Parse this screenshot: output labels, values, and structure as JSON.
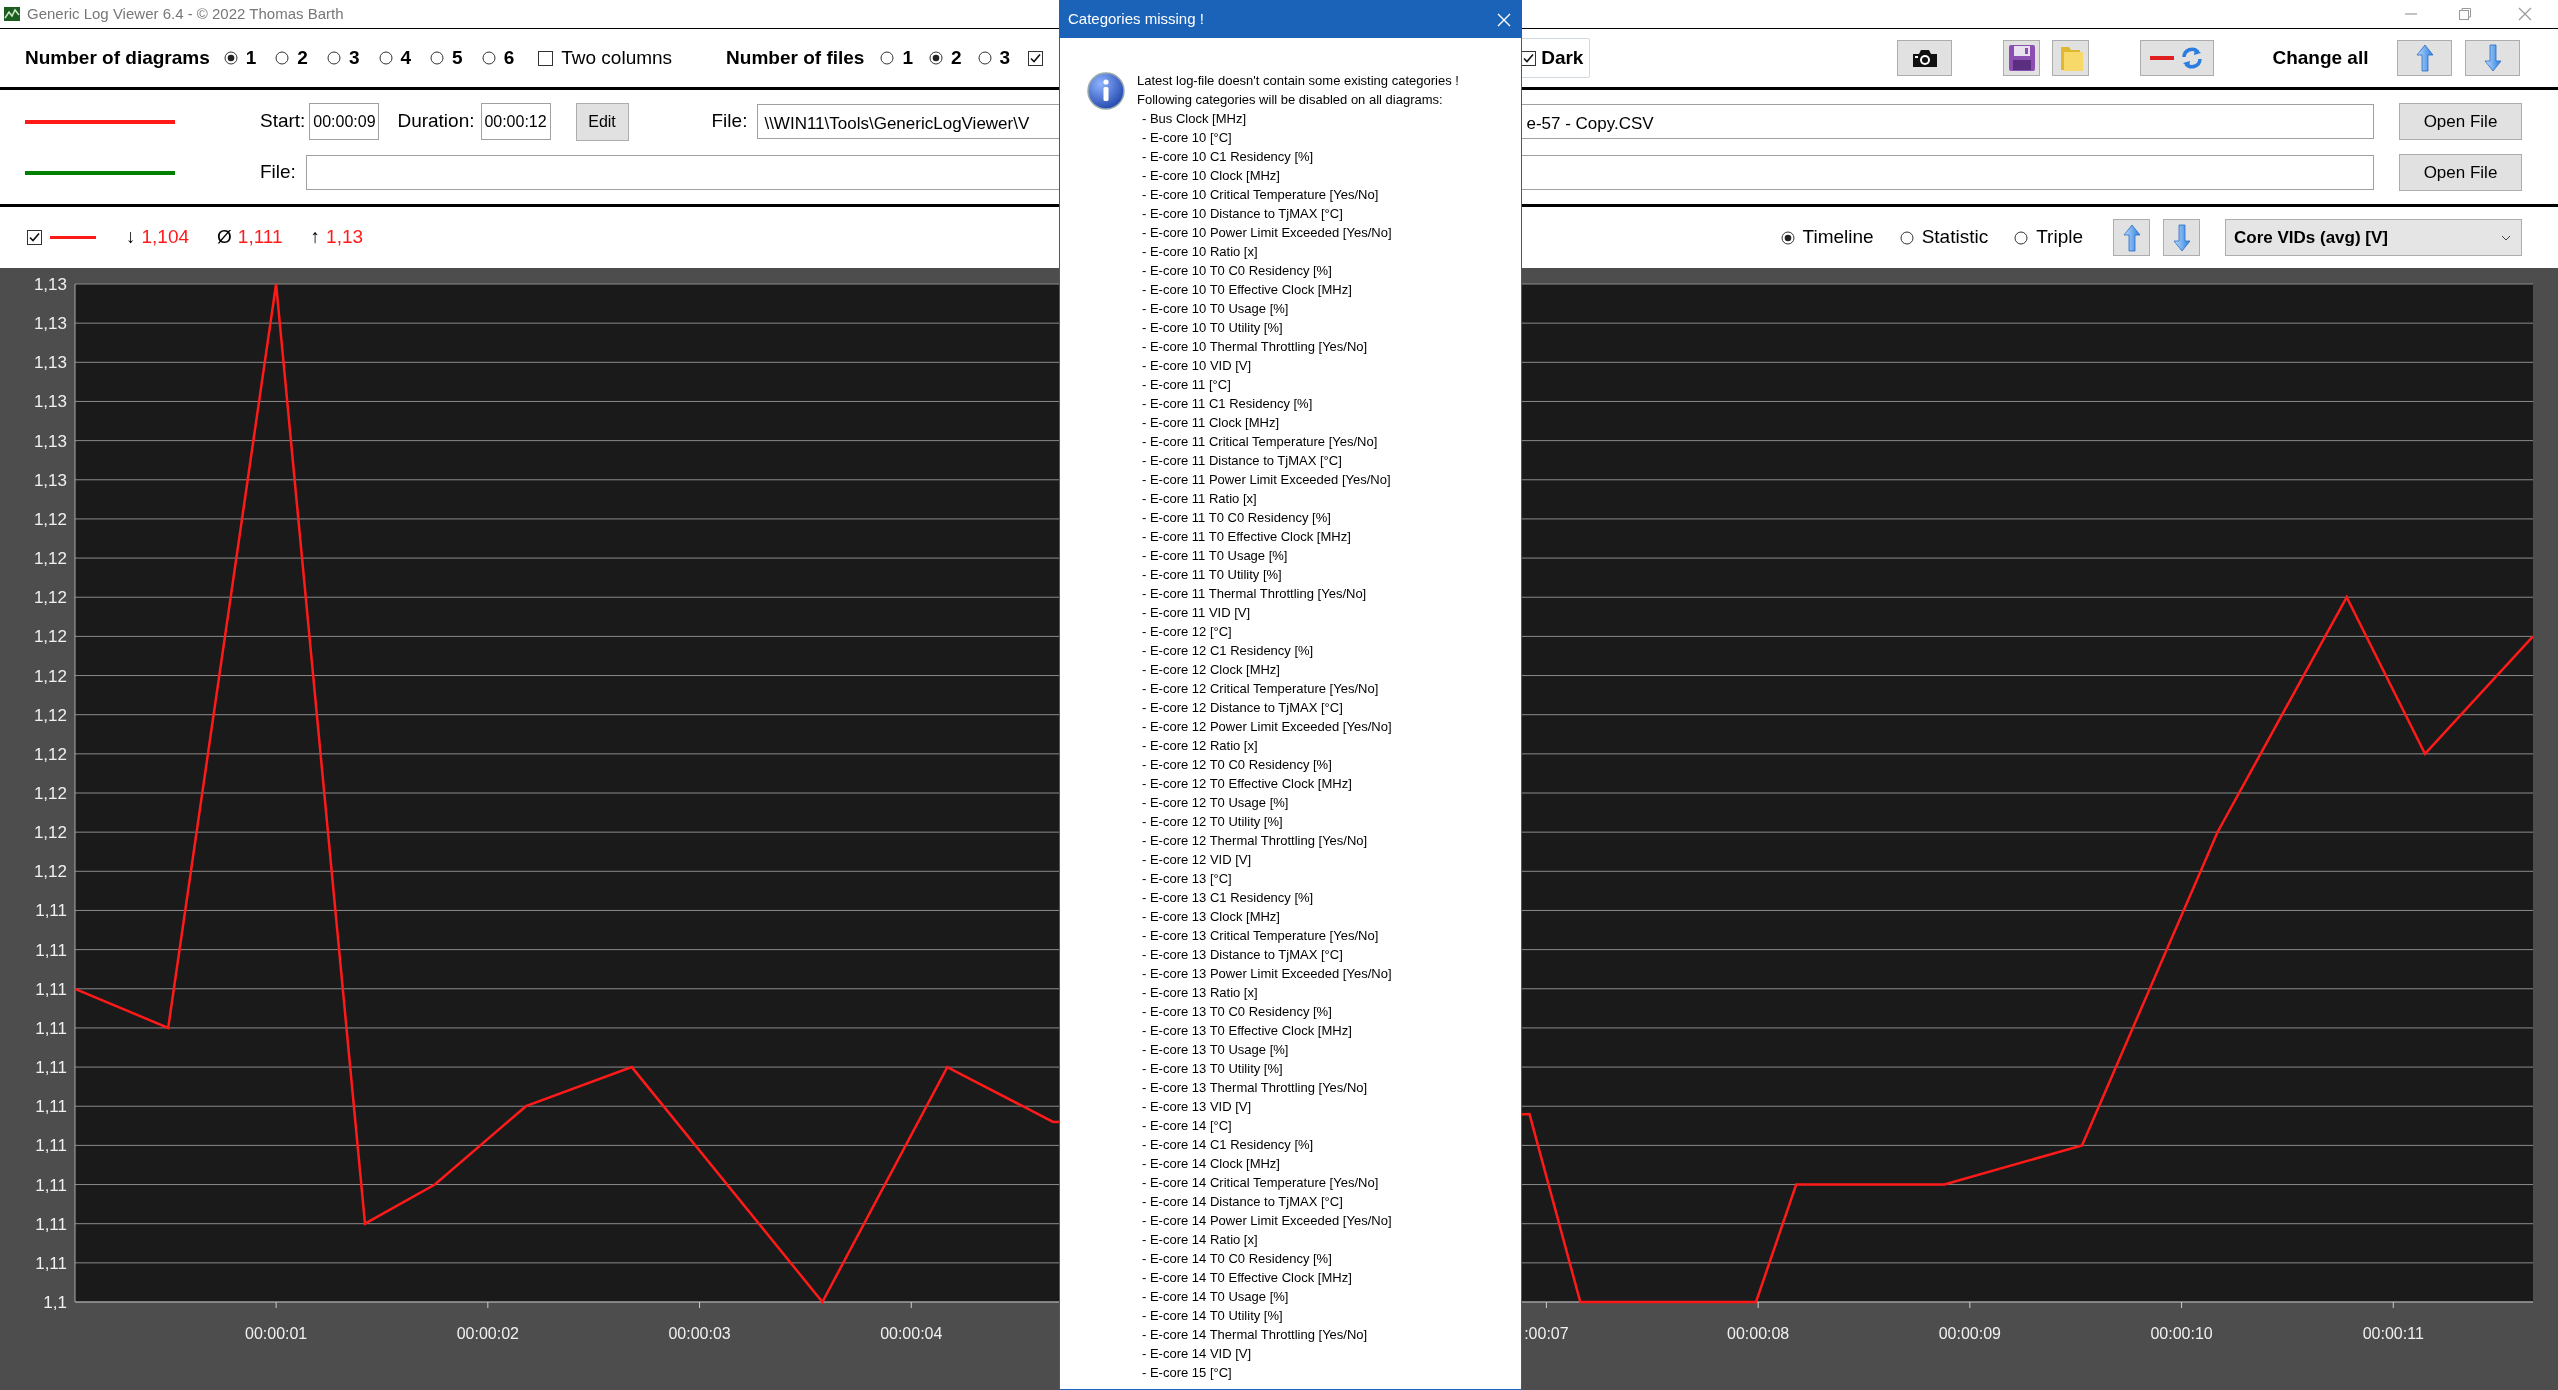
{
  "window": {
    "title": "Generic Log Viewer 6.4 - © 2022 Thomas Barth"
  },
  "toolbar": {
    "diagrams_label": "Number of diagrams",
    "diagram_options": [
      {
        "label": "1",
        "selected": true
      },
      {
        "label": "2",
        "selected": false
      },
      {
        "label": "3",
        "selected": false
      },
      {
        "label": "4",
        "selected": false
      },
      {
        "label": "5",
        "selected": false
      },
      {
        "label": "6",
        "selected": false
      }
    ],
    "two_columns": {
      "label": "Two columns",
      "checked": false
    },
    "files_label": "Number of files",
    "file_options": [
      {
        "label": "1",
        "selected": false
      },
      {
        "label": "2",
        "selected": true
      },
      {
        "label": "3",
        "selected": false
      }
    ],
    "covered_checkbox": {
      "checked": true
    },
    "dark": {
      "label": "Dark",
      "checked": true
    },
    "change_all_label": "Change all"
  },
  "files": [
    {
      "kind": "timed",
      "color": "#ff1a1a",
      "start_label": "Start:",
      "start": "00:00:09",
      "duration_label": "Duration:",
      "duration": "00:00:12",
      "edit_button": "Edit",
      "file_label": "File:",
      "file_value_start": "\\\\WIN11\\Tools\\GenericLogViewer\\V",
      "file_value_end": "e-57 - Copy.CSV",
      "open_button": "Open File"
    },
    {
      "kind": "plain",
      "color": "#008000",
      "file_label": "File:",
      "open_button": "Open File"
    }
  ],
  "diagram": {
    "visible": {
      "checked": true
    },
    "color": "#ff1a1a",
    "stats": [
      {
        "symbol": "↓",
        "value": "1,104"
      },
      {
        "symbol": "Ø",
        "value": "1,111"
      },
      {
        "symbol": "↑",
        "value": "1,13"
      }
    ],
    "views": [
      {
        "label": "Timeline",
        "selected": true
      },
      {
        "label": "Statistic",
        "selected": false
      },
      {
        "label": "Triple",
        "selected": false
      }
    ],
    "category": "Core VIDs (avg) [V]",
    "chart_data": {
      "type": "line",
      "x": [
        0.05,
        0.49,
        1.0,
        1.42,
        1.75,
        2.18,
        2.68,
        3.58,
        4.17,
        4.67,
        6.92,
        7.16,
        7.99,
        8.18,
        8.88,
        9.53,
        10.17,
        10.78,
        11.15,
        11.66
      ],
      "series": [
        {
          "color": "#ff1a1a",
          "values": [
            1.112,
            1.111,
            1.13,
            1.106,
            1.107,
            1.109,
            1.11,
            1.104,
            1.11,
            1.1086,
            1.1088,
            1.104,
            1.104,
            1.107,
            1.107,
            1.108,
            1.116,
            1.122,
            1.118,
            1.121
          ]
        }
      ],
      "xlim": [
        0.05,
        11.66
      ],
      "ylim": [
        1.104,
        1.13
      ],
      "grid": true,
      "xticks": [
        {
          "value": 1,
          "label": "00:00:01"
        },
        {
          "value": 2,
          "label": "00:00:02"
        },
        {
          "value": 3,
          "label": "00:00:03"
        },
        {
          "value": 4,
          "label": "00:00:04"
        },
        {
          "value": 7,
          "label": ":00:07"
        },
        {
          "value": 8,
          "label": "00:00:08"
        },
        {
          "value": 9,
          "label": "00:00:09"
        },
        {
          "value": 10,
          "label": "00:00:10"
        },
        {
          "value": 11,
          "label": "00:00:11"
        }
      ],
      "yticks": [
        {
          "value": 1.13,
          "label": "1,13"
        },
        {
          "value": 1.129,
          "label": "1,13"
        },
        {
          "value": 1.128,
          "label": "1,13"
        },
        {
          "value": 1.127,
          "label": "1,13"
        },
        {
          "value": 1.126,
          "label": "1,13"
        },
        {
          "value": 1.125,
          "label": "1,13"
        },
        {
          "value": 1.124,
          "label": "1,12"
        },
        {
          "value": 1.123,
          "label": "1,12"
        },
        {
          "value": 1.122,
          "label": "1,12"
        },
        {
          "value": 1.121,
          "label": "1,12"
        },
        {
          "value": 1.12,
          "label": "1,12"
        },
        {
          "value": 1.119,
          "label": "1,12"
        },
        {
          "value": 1.118,
          "label": "1,12"
        },
        {
          "value": 1.117,
          "label": "1,12"
        },
        {
          "value": 1.116,
          "label": "1,12"
        },
        {
          "value": 1.115,
          "label": "1,12"
        },
        {
          "value": 1.114,
          "label": "1,11"
        },
        {
          "value": 1.113,
          "label": "1,11"
        },
        {
          "value": 1.112,
          "label": "1,11"
        },
        {
          "value": 1.111,
          "label": "1,11"
        },
        {
          "value": 1.11,
          "label": "1,11"
        },
        {
          "value": 1.109,
          "label": "1,11"
        },
        {
          "value": 1.108,
          "label": "1,11"
        },
        {
          "value": 1.107,
          "label": "1,11"
        },
        {
          "value": 1.106,
          "label": "1,11"
        },
        {
          "value": 1.105,
          "label": "1,11"
        },
        {
          "value": 1.104,
          "label": "1,1"
        }
      ]
    }
  },
  "dialog": {
    "title": "Categories missing !",
    "message": [
      "Latest log-file doesn't contain some existing categories !",
      "Following categories will be disabled on all diagrams:"
    ],
    "items": [
      "- Bus Clock [MHz]",
      "- E-core 10 [°C]",
      "- E-core 10 C1 Residency [%]",
      "- E-core 10 Clock [MHz]",
      "- E-core 10 Critical Temperature [Yes/No]",
      "- E-core 10 Distance to TjMAX [°C]",
      "- E-core 10 Power Limit Exceeded [Yes/No]",
      "- E-core 10 Ratio [x]",
      "- E-core 10 T0 C0 Residency [%]",
      "- E-core 10 T0 Effective Clock [MHz]",
      "- E-core 10 T0 Usage [%]",
      "- E-core 10 T0 Utility [%]",
      "- E-core 10 Thermal Throttling [Yes/No]",
      "- E-core 10 VID [V]",
      "- E-core 11 [°C]",
      "- E-core 11 C1 Residency [%]",
      "- E-core 11 Clock [MHz]",
      "- E-core 11 Critical Temperature [Yes/No]",
      "- E-core 11 Distance to TjMAX [°C]",
      "- E-core 11 Power Limit Exceeded [Yes/No]",
      "- E-core 11 Ratio [x]",
      "- E-core 11 T0 C0 Residency [%]",
      "- E-core 11 T0 Effective Clock [MHz]",
      "- E-core 11 T0 Usage [%]",
      "- E-core 11 T0 Utility [%]",
      "- E-core 11 Thermal Throttling [Yes/No]",
      "- E-core 11 VID [V]",
      "- E-core 12 [°C]",
      "- E-core 12 C1 Residency [%]",
      "- E-core 12 Clock [MHz]",
      "- E-core 12 Critical Temperature [Yes/No]",
      "- E-core 12 Distance to TjMAX [°C]",
      "- E-core 12 Power Limit Exceeded [Yes/No]",
      "- E-core 12 Ratio [x]",
      "- E-core 12 T0 C0 Residency [%]",
      "- E-core 12 T0 Effective Clock [MHz]",
      "- E-core 12 T0 Usage [%]",
      "- E-core 12 T0 Utility [%]",
      "- E-core 12 Thermal Throttling [Yes/No]",
      "- E-core 12 VID [V]",
      "- E-core 13 [°C]",
      "- E-core 13 C1 Residency [%]",
      "- E-core 13 Clock [MHz]",
      "- E-core 13 Critical Temperature [Yes/No]",
      "- E-core 13 Distance to TjMAX [°C]",
      "- E-core 13 Power Limit Exceeded [Yes/No]",
      "- E-core 13 Ratio [x]",
      "- E-core 13 T0 C0 Residency [%]",
      "- E-core 13 T0 Effective Clock [MHz]",
      "- E-core 13 T0 Usage [%]",
      "- E-core 13 T0 Utility [%]",
      "- E-core 13 Thermal Throttling [Yes/No]",
      "- E-core 13 VID [V]",
      "- E-core 14 [°C]",
      "- E-core 14 C1 Residency [%]",
      "- E-core 14 Clock [MHz]",
      "- E-core 14 Critical Temperature [Yes/No]",
      "- E-core 14 Distance to TjMAX [°C]",
      "- E-core 14 Power Limit Exceeded [Yes/No]",
      "- E-core 14 Ratio [x]",
      "- E-core 14 T0 C0 Residency [%]",
      "- E-core 14 T0 Effective Clock [MHz]",
      "- E-core 14 T0 Usage [%]",
      "- E-core 14 T0 Utility [%]",
      "- E-core 14 Thermal Throttling [Yes/No]",
      "- E-core 14 VID [V]",
      "- E-core 15 [°C]"
    ]
  }
}
